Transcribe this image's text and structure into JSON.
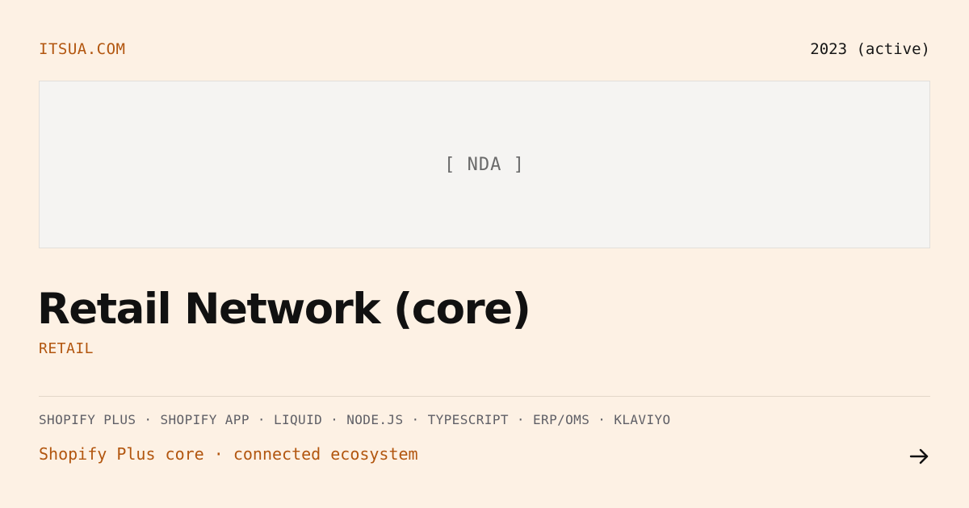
{
  "header": {
    "site": "ITSUA.COM",
    "year": "2023 (active)"
  },
  "preview": {
    "placeholder": "[ NDA ]"
  },
  "project": {
    "title": "Retail Network (core)",
    "category": "RETAIL",
    "tech_stack": "SHOPIFY PLUS · SHOPIFY APP · LIQUID · NODE.JS · TYPESCRIPT · ERP/OMS · KLAVIYO",
    "tagline": "Shopify Plus core · connected ecosystem"
  },
  "icons": {
    "next": "arrow-right-icon"
  },
  "colors": {
    "background": "#fdf1e4",
    "accent": "#b2560f",
    "text": "#111111",
    "muted": "#5f5f66",
    "preview_bg": "#f5f4f2"
  }
}
